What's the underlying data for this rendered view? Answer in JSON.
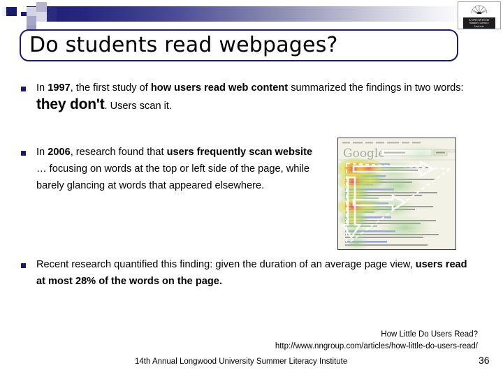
{
  "slide": {
    "title": "Do students read webpages?",
    "number": "36"
  },
  "logo": {
    "name": "LONGWOOD",
    "line2": "Summer Literacy",
    "line3": "Institute"
  },
  "bullets": [
    {
      "id": "bullet-1997",
      "segments": [
        {
          "text": "In ",
          "style": "normal"
        },
        {
          "text": "1997",
          "style": "bold"
        },
        {
          "text": ", the first study of ",
          "style": "normal"
        },
        {
          "text": "how users read web content",
          "style": "bold"
        },
        {
          "text": " summarized the findings in two words: ",
          "style": "normal"
        },
        {
          "text": "they don't",
          "style": "big"
        },
        {
          "text": ". Users scan it.",
          "style": "normal"
        }
      ]
    },
    {
      "id": "bullet-2006",
      "segments": [
        {
          "text": "In ",
          "style": "normal"
        },
        {
          "text": "2006",
          "style": "bold"
        },
        {
          "text": ", research found that ",
          "style": "normal"
        },
        {
          "text": "users frequently scan website",
          "style": "bold"
        },
        {
          "text": " … focusing on words at the top or left side of the page, while barely glancing at words that appeared elsewhere.",
          "style": "normal"
        }
      ]
    },
    {
      "id": "bullet-recent",
      "segments": [
        {
          "text": "Recent research quantified this finding: given the duration of an average page view, ",
          "style": "normal"
        },
        {
          "text": "users read at most 28% of the words on the page.",
          "style": "bold"
        }
      ]
    }
  ],
  "image": {
    "alt_name": "google-search-eyetracking-f-pattern-heatmap",
    "brand_text": "Google",
    "search_button": "Search"
  },
  "footer": {
    "citation_title": "How Little Do Users Read?",
    "citation_url": "http://www.nngroup.com/articles/how-little-do-users-read/",
    "conference": "14th Annual Longwood University Summer Literacy Institute"
  },
  "colors": {
    "navy": "#1b1b6e",
    "bullet": "#1b1b6e",
    "title_border": "#1b1b6e"
  }
}
